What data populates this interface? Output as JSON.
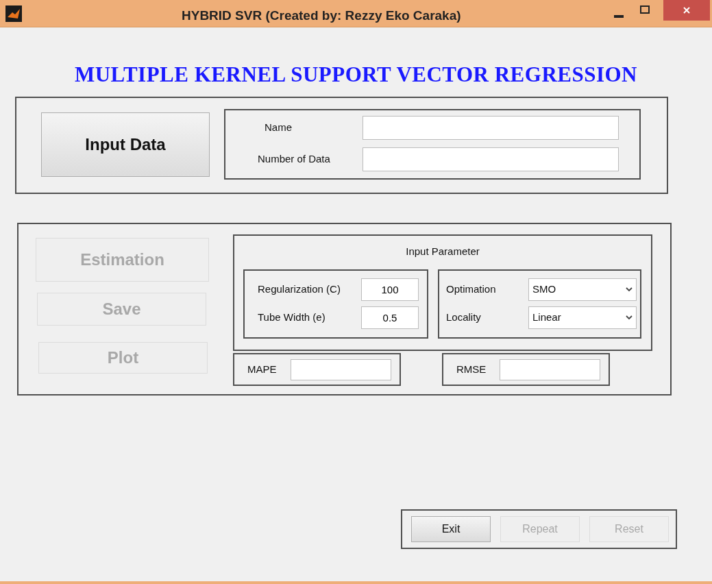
{
  "window": {
    "title": "HYBRID SVR (Created by: Rezzy Eko Caraka)"
  },
  "heading": "MULTIPLE KERNEL SUPPORT VECTOR REGRESSION",
  "data_panel": {
    "button": {
      "label": "Input Data",
      "disabled": false
    },
    "fields": [
      {
        "label": "Name"
      },
      {
        "label": "Number of Data"
      }
    ]
  },
  "actions": [
    {
      "label": "Estimation",
      "disabled": true
    },
    {
      "label": "Save",
      "disabled": true
    },
    {
      "label": "Plot",
      "disabled": true
    }
  ],
  "parameters": {
    "title": "Input Parameter",
    "inputs": [
      {
        "label": "Regularization (C)",
        "value": "100"
      },
      {
        "label": "Tube Width (e)",
        "value": "0.5"
      }
    ],
    "selects": [
      {
        "label": "Optimation",
        "value": "SMO"
      },
      {
        "label": "Locality",
        "value": "Linear"
      }
    ]
  },
  "metrics": [
    {
      "label": "MAPE"
    },
    {
      "label": "RMSE"
    }
  ],
  "footer_buttons": [
    {
      "label": "Exit",
      "disabled": false
    },
    {
      "label": "Repeat",
      "disabled": true
    },
    {
      "label": "Reset",
      "disabled": true
    }
  ]
}
